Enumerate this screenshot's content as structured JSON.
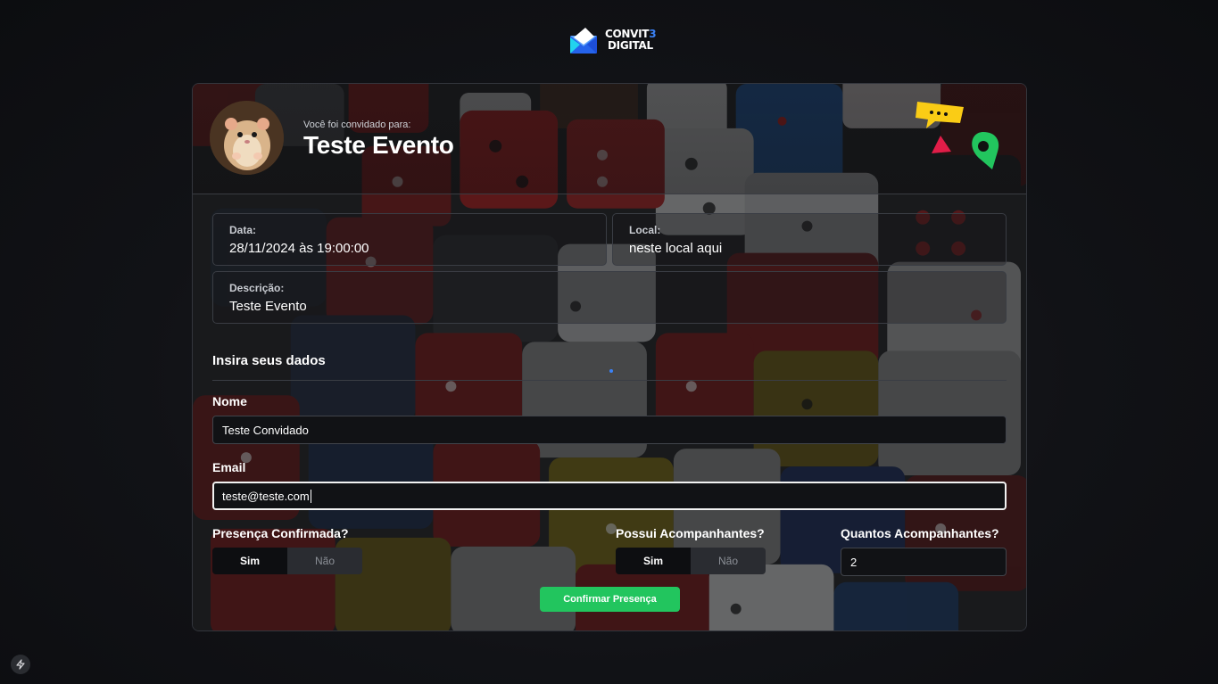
{
  "logo": {
    "line1_main": "CONVIT",
    "line1_accent": "3",
    "line2": "DIGITAL"
  },
  "header": {
    "invited_label": "Você foi convidado para:",
    "event_title": "Teste Evento"
  },
  "info": {
    "date_label": "Data:",
    "date_value": "28/11/2024 às 19:00:00",
    "local_label": "Local:",
    "local_value": "neste local aqui",
    "desc_label": "Descrição:",
    "desc_value": "Teste Evento"
  },
  "form": {
    "section_title": "Insira seus dados",
    "name_label": "Nome",
    "name_value": "Teste Convidado",
    "email_label": "Email",
    "email_value": "teste@teste.com",
    "presence_label": "Presença Confirmada?",
    "presence_yes": "Sim",
    "presence_no": "Não",
    "companions_label": "Possui Acompanhantes?",
    "companions_yes": "Sim",
    "companions_no": "Não",
    "how_many_label": "Quantos Acompanhantes?",
    "how_many_value": "2",
    "submit_label": "Confirmar Presença"
  },
  "colors": {
    "accent_green": "#22c55e",
    "accent_blue": "#3b82f6",
    "deco_yellow": "#facc15",
    "deco_red": "#e11d48"
  },
  "icons": [
    "logo-envelope-icon",
    "chat-bubble-icon",
    "paper-plane-icon",
    "map-pin-icon",
    "bolt-icon"
  ]
}
